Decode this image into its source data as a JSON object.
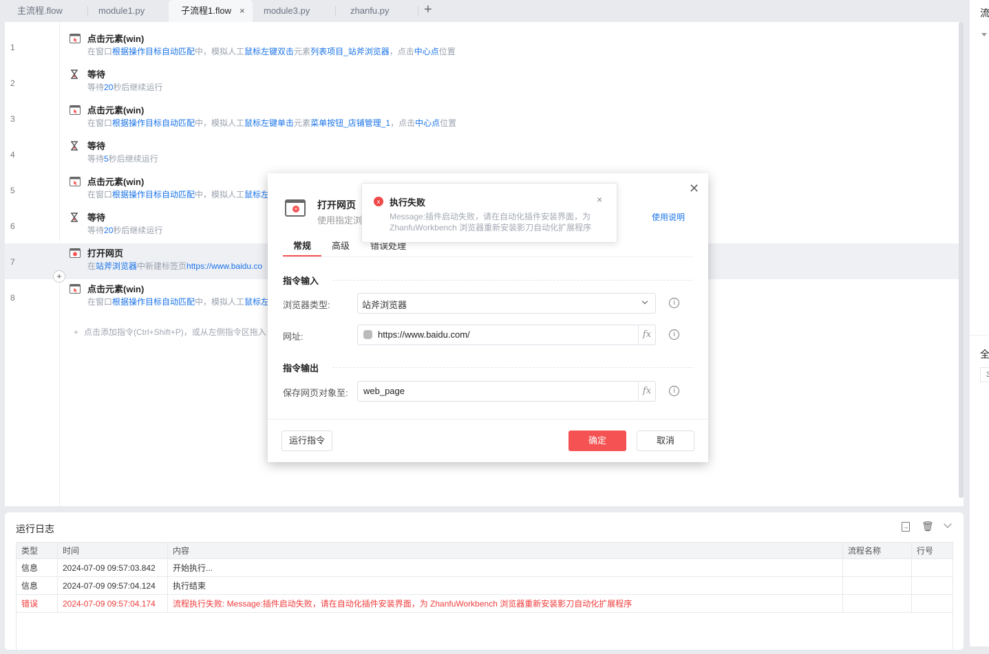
{
  "tabs": [
    {
      "label": "主流程.flow"
    },
    {
      "label": "module1.py"
    },
    {
      "label": "子流程1.flow",
      "active": true
    },
    {
      "label": "module3.py"
    },
    {
      "label": "zhanfu.py"
    }
  ],
  "tab_add": "+",
  "tab_close": "×",
  "steps": [
    {
      "line": "1",
      "icon": "click-element-icon",
      "title": "点击元素(win)",
      "desc": [
        {
          "t": "在窗口"
        },
        {
          "t": "根据操作目标自动匹配",
          "hl": 1
        },
        {
          "t": "中，模拟人工"
        },
        {
          "t": "鼠标左键双击",
          "hl": 1
        },
        {
          "t": "元素"
        },
        {
          "t": "列表项目_站斧浏览器",
          "hl": 1
        },
        {
          "t": "，点击"
        },
        {
          "t": "中心点",
          "hl": 1
        },
        {
          "t": "位置"
        }
      ]
    },
    {
      "line": "2",
      "icon": "hourglass-icon",
      "title": "等待",
      "desc": [
        {
          "t": "等待"
        },
        {
          "t": "20",
          "hl": 1
        },
        {
          "t": "秒后继续运行"
        }
      ]
    },
    {
      "line": "3",
      "icon": "click-element-icon",
      "title": "点击元素(win)",
      "desc": [
        {
          "t": "在窗口"
        },
        {
          "t": "根据操作目标自动匹配",
          "hl": 1
        },
        {
          "t": "中，模拟人工"
        },
        {
          "t": "鼠标左键单击",
          "hl": 1
        },
        {
          "t": "元素"
        },
        {
          "t": "菜单按钮_店铺管理_1",
          "hl": 1
        },
        {
          "t": "，点击"
        },
        {
          "t": "中心点",
          "hl": 1
        },
        {
          "t": "位置"
        }
      ]
    },
    {
      "line": "4",
      "icon": "hourglass-icon",
      "title": "等待",
      "desc": [
        {
          "t": "等待"
        },
        {
          "t": "5",
          "hl": 1
        },
        {
          "t": "秒后继续运行"
        }
      ]
    },
    {
      "line": "5",
      "icon": "click-element-icon",
      "title": "点击元素(win)",
      "desc": [
        {
          "t": "在窗口"
        },
        {
          "t": "根据操作目标自动匹配",
          "hl": 1
        },
        {
          "t": "中，模拟人工"
        },
        {
          "t": "鼠标左",
          "hl": 1
        }
      ]
    },
    {
      "line": "6",
      "icon": "hourglass-icon",
      "title": "等待",
      "desc": [
        {
          "t": "等待"
        },
        {
          "t": "20",
          "hl": 1
        },
        {
          "t": "秒后继续运行"
        }
      ]
    },
    {
      "line": "7",
      "icon": "open-webpage-icon",
      "title": "打开网页",
      "selected": true,
      "desc": [
        {
          "t": "在"
        },
        {
          "t": "站斧浏览器",
          "hl": 1
        },
        {
          "t": "中新建标签页"
        },
        {
          "t": "https://www.baidu.co",
          "hl": 1
        }
      ]
    },
    {
      "line": "8",
      "icon": "click-element-icon",
      "title": "点击元素(win)",
      "desc": [
        {
          "t": "在窗口"
        },
        {
          "t": "根据操作目标自动匹配",
          "hl": 1
        },
        {
          "t": "中，模拟人工"
        },
        {
          "t": "鼠标左",
          "hl": 1
        }
      ]
    }
  ],
  "add_hint": "点击添加指令(Ctrl+Shift+P)，或从左侧指令区拖入",
  "dialog": {
    "title": "打开网页",
    "desc": "使用指定浏",
    "help": "使用说明",
    "tabs": [
      "常规",
      "高级",
      "错误处理"
    ],
    "section_input": "指令输入",
    "browser_label": "浏览器类型:",
    "browser_value": "站斧浏览器",
    "url_label": "网址:",
    "url_value": "https://www.baidu.com/",
    "section_output": "指令输出",
    "save_label": "保存网页对象至:",
    "save_value": "web_page",
    "fx": "fx",
    "run": "运行指令",
    "ok": "确定",
    "cancel": "取消"
  },
  "toast": {
    "title": "执行失败",
    "message": "Message:插件启动失败，请在自动化插件安装界面，为 ZhanfuWorkbench 浏览器重新安装影刀自动化扩展程序"
  },
  "log": {
    "title": "运行日志",
    "columns": [
      "类型",
      "时间",
      "内容",
      "流程名称",
      "行号"
    ],
    "rows": [
      {
        "type": "信息",
        "time": "2024-07-09 09:57:03.842",
        "content": "开始执行...",
        "flow": "",
        "line": ""
      },
      {
        "type": "信息",
        "time": "2024-07-09 09:57:04.124",
        "content": "执行结束",
        "flow": "",
        "line": ""
      },
      {
        "type": "错误",
        "time": "2024-07-09 09:57:04.174",
        "content": "流程执行失败: Message:插件启动失败，请在自动化插件安装界面，为 ZhanfuWorkbench 浏览器重新安装影刀自动化扩展程序",
        "flow": "",
        "line": "",
        "error": true
      }
    ]
  },
  "right_panel": {
    "title_char": "流",
    "section_char": "全",
    "box_char": "3"
  },
  "colors": {
    "accent": "#1a73e8",
    "danger": "#f55353",
    "error_text": "#f03b3b"
  }
}
